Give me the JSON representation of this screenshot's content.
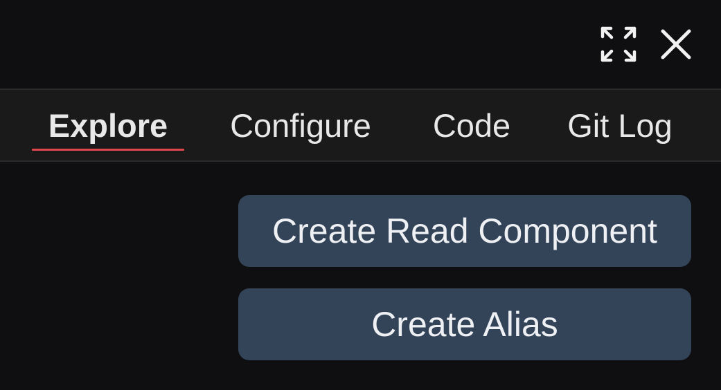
{
  "window": {
    "expand_icon": "expand-arrows-icon",
    "close_icon": "close-x-icon"
  },
  "tabs": [
    {
      "label": "Explore",
      "active": true
    },
    {
      "label": "Configure",
      "active": false
    },
    {
      "label": "Code",
      "active": false
    },
    {
      "label": "Git Log",
      "active": false
    }
  ],
  "actions": {
    "create_read_component": "Create Read Component",
    "create_alias": "Create Alias"
  },
  "colors": {
    "background": "#0f0e10",
    "tabbar": "#1b1a1a",
    "active_underline": "#e0474c",
    "button_bg": "#334458",
    "text": "#ececec"
  }
}
